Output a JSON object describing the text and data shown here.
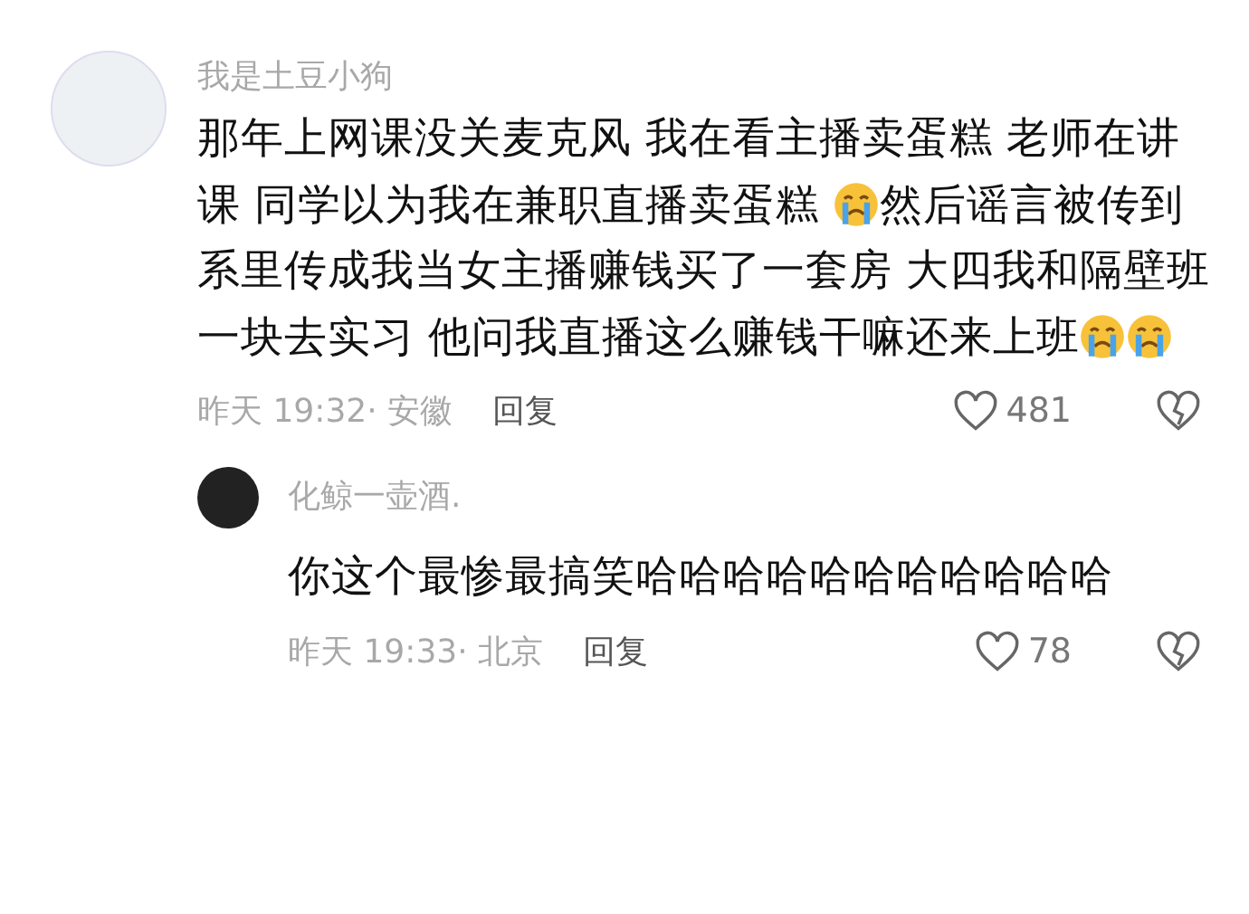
{
  "comment": {
    "author": "我是土豆小狗",
    "body": [
      {
        "kind": "text",
        "text": "那年上网课没关麦克风 我在看主播卖蛋糕 老师在讲课 同学以为我在兼职直播卖蛋糕 "
      },
      {
        "kind": "emoji"
      },
      {
        "kind": "text",
        "text": "然后谣言被传到系里传成我当女主播赚钱买了一套房 大四我和隔壁班一块去实习 他问我直播这么赚钱干嘛还来上班"
      },
      {
        "kind": "emoji"
      },
      {
        "kind": "emoji"
      }
    ],
    "time": "昨天 19:32· 安徽",
    "reply": "回复",
    "likes": "481"
  },
  "replies": [
    {
      "author": "化鲸一壶酒.",
      "body": [
        {
          "kind": "text",
          "text": "你这个最惨最搞笑哈哈哈哈哈哈哈哈哈哈哈"
        }
      ],
      "time": "昨天 19:33· 北京",
      "reply": "回复",
      "likes": "78"
    }
  ]
}
